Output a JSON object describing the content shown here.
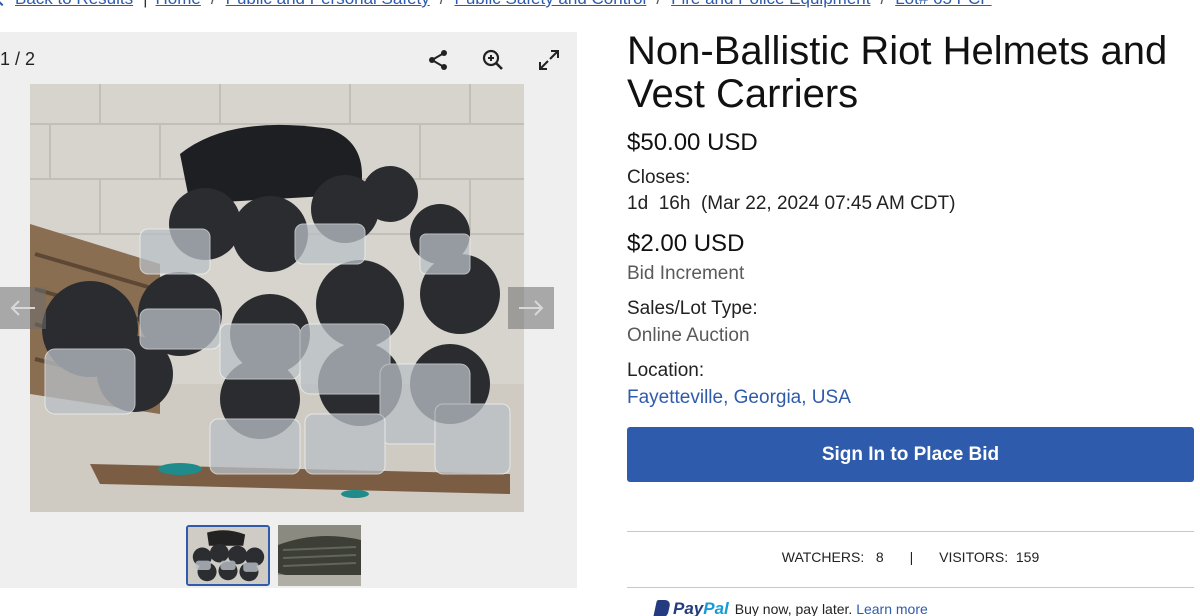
{
  "breadcrumb": {
    "back_label": "Back to Results",
    "items": [
      "Home",
      "Public and Personal Safety",
      "Public Safety and Control",
      "Fire and Police Equipment",
      "Lot# 65 PCP"
    ]
  },
  "gallery": {
    "counter": "1 / 2",
    "tools": [
      "share-icon",
      "zoom-in-icon",
      "fullscreen-icon"
    ],
    "thumbnails_count": 2,
    "active_thumbnail": 1
  },
  "listing": {
    "title": "Non-Ballistic Riot Helmets and Vest Carriers",
    "price": "$50.00 USD",
    "closes_label": "Closes:",
    "closes_value": "1d  16h  (Mar 22, 2024 07:45 AM CDT)",
    "increment_value": "$2.00 USD",
    "increment_label": "Bid Increment",
    "type_label": "Sales/Lot Type:",
    "type_value": "Online Auction",
    "location_label": "Location:",
    "location_value": "Fayetteville, Georgia, USA",
    "bid_button": "Sign In to Place Bid"
  },
  "stats": {
    "watchers_label": "WATCHERS:",
    "watchers_value": "8",
    "divider": "|",
    "visitors_label": "VISITORS:",
    "visitors_value": "159"
  },
  "paypal": {
    "logo_pay": "Pay",
    "logo_pal": "Pal",
    "text": "Buy now, pay later.",
    "link": "Learn more"
  },
  "colors": {
    "accent": "#2e5bab",
    "gallery_bg": "#efefef",
    "paypal_dark": "#253b80",
    "paypal_light": "#179bd7"
  }
}
